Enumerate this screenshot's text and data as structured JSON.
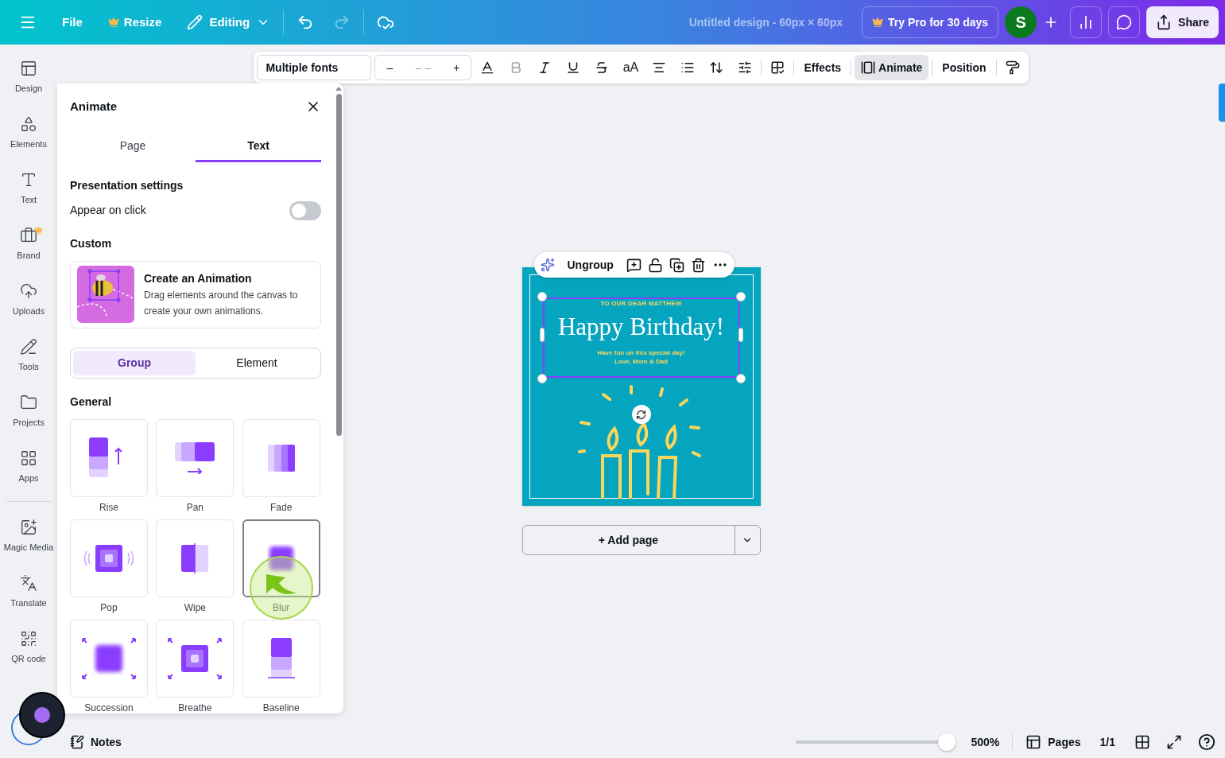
{
  "topbar": {
    "file": "File",
    "resize": "Resize",
    "mode": "Editing",
    "redo_disabled": true,
    "title": "Untitled design - 60px × 60px",
    "pro": "Try Pro for 30 days",
    "avatar": "S",
    "share": "Share"
  },
  "rail": [
    {
      "kind": "design",
      "label": "Design"
    },
    {
      "kind": "elements",
      "label": "Elements"
    },
    {
      "kind": "text",
      "label": "Text"
    },
    {
      "kind": "brand",
      "label": "Brand"
    },
    {
      "kind": "uploads",
      "label": "Uploads"
    },
    {
      "kind": "tools",
      "label": "Tools"
    },
    {
      "kind": "projects",
      "label": "Projects"
    },
    {
      "kind": "apps",
      "label": "Apps"
    },
    {
      "kind": "magic",
      "label": "Magic Media"
    },
    {
      "kind": "translate",
      "label": "Translate"
    },
    {
      "kind": "qr",
      "label": "QR code"
    }
  ],
  "toolbar": {
    "font": "Multiple fonts",
    "minus": "–",
    "size": "– –",
    "plus": "+",
    "bold_disabled": true,
    "case": "aA",
    "buttons": [
      {
        "label": "Effects",
        "selected": false
      },
      {
        "label": "Animate",
        "selected": true
      },
      {
        "label": "Position",
        "selected": false
      }
    ]
  },
  "panel": {
    "title": "Animate",
    "tabs": [
      {
        "label": "Page",
        "selected": false
      },
      {
        "label": "Text",
        "selected": true
      }
    ],
    "presentation": "Presentation settings",
    "appear": {
      "label": "Appear on click",
      "on": false
    },
    "custom": "Custom",
    "create": {
      "title": "Create an Animation",
      "text": "Drag elements around the canvas to create your own animations."
    },
    "scope": [
      {
        "label": "Group",
        "selected": true
      },
      {
        "label": "Element",
        "selected": false
      }
    ],
    "general": "General",
    "effects": [
      {
        "kind": "rise",
        "label": "Rise",
        "selected": false
      },
      {
        "kind": "pan",
        "label": "Pan",
        "selected": false
      },
      {
        "kind": "fade",
        "label": "Fade",
        "selected": false
      },
      {
        "kind": "pop",
        "label": "Pop",
        "selected": false
      },
      {
        "kind": "wipe",
        "label": "Wipe",
        "selected": false
      },
      {
        "kind": "blur",
        "label": "Blur",
        "selected": true
      },
      {
        "kind": "succession",
        "label": "Succession",
        "selected": false
      },
      {
        "kind": "breathe",
        "label": "Breathe",
        "selected": false
      },
      {
        "kind": "baseline",
        "label": "Baseline",
        "selected": false
      }
    ]
  },
  "canvas": {
    "context": {
      "ungroup": "Ungroup"
    },
    "card": {
      "to": "TO OUR DEAR MATTHEW",
      "heading": "Happy Birthday!",
      "line1": "Have fun on this special day!",
      "line2": "Love, Mom & Dad"
    },
    "add_page": "+ Add page"
  },
  "bottom": {
    "notes": "Notes",
    "zoom": {
      "level": 1,
      "reading": "500%"
    },
    "pages": "Pages",
    "count": "1/1"
  }
}
